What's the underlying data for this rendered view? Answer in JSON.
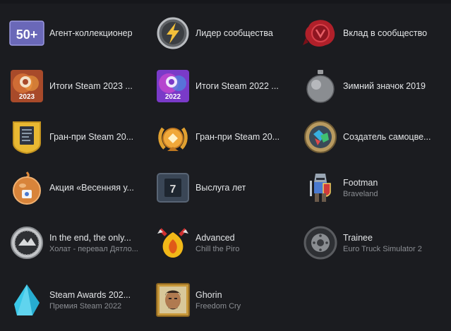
{
  "badges": [
    {
      "title": "Агент-коллекционер",
      "subtitle": "",
      "icon": "collector-50-icon",
      "icon_text": "50+"
    },
    {
      "title": "Лидер сообщества",
      "subtitle": "",
      "icon": "lightning-icon"
    },
    {
      "title": "Вклад в сообщество",
      "subtitle": "",
      "icon": "wax-seal-icon"
    },
    {
      "title": "Итоги Steam 2023 ...",
      "subtitle": "",
      "icon": "steam-2023-icon",
      "icon_text": "2023"
    },
    {
      "title": "Итоги Steam 2022 ...",
      "subtitle": "",
      "icon": "steam-2022-icon",
      "icon_text": "2022"
    },
    {
      "title": "Зимний значок 2019",
      "subtitle": "",
      "icon": "ornament-icon"
    },
    {
      "title": "Гран-при Steam 20...",
      "subtitle": "",
      "icon": "grand-prix-card-icon"
    },
    {
      "title": "Гран-при Steam 20...",
      "subtitle": "",
      "icon": "grand-prix-laurel-icon"
    },
    {
      "title": "Создатель самоцве...",
      "subtitle": "",
      "icon": "gem-creator-icon"
    },
    {
      "title": "Акция «Весенняя у...",
      "subtitle": "",
      "icon": "spring-sale-icon"
    },
    {
      "title": "Выслуга лет",
      "subtitle": "",
      "icon": "years-of-service-icon",
      "icon_text": "7"
    },
    {
      "title": "Footman",
      "subtitle": "Braveland",
      "icon": "footman-knight-icon"
    },
    {
      "title": "In the end, the only...",
      "subtitle": "Холат - перевал Дятло...",
      "icon": "kholat-coin-icon"
    },
    {
      "title": "Advanced",
      "subtitle": "Chill the Piro",
      "icon": "fire-helmet-icon"
    },
    {
      "title": "Trainee",
      "subtitle": "Euro Truck Simulator 2",
      "icon": "truck-wheel-icon"
    },
    {
      "title": "Steam Awards 202...",
      "subtitle": "Премия Steam 2022",
      "icon": "steam-awards-crystal-icon"
    },
    {
      "title": "Ghorin",
      "subtitle": "Freedom Cry",
      "icon": "ghorin-portrait-icon"
    }
  ],
  "colors": {
    "background": "#1b1c20",
    "title": "#e4e6e8",
    "subtitle": "#8b8e93"
  }
}
